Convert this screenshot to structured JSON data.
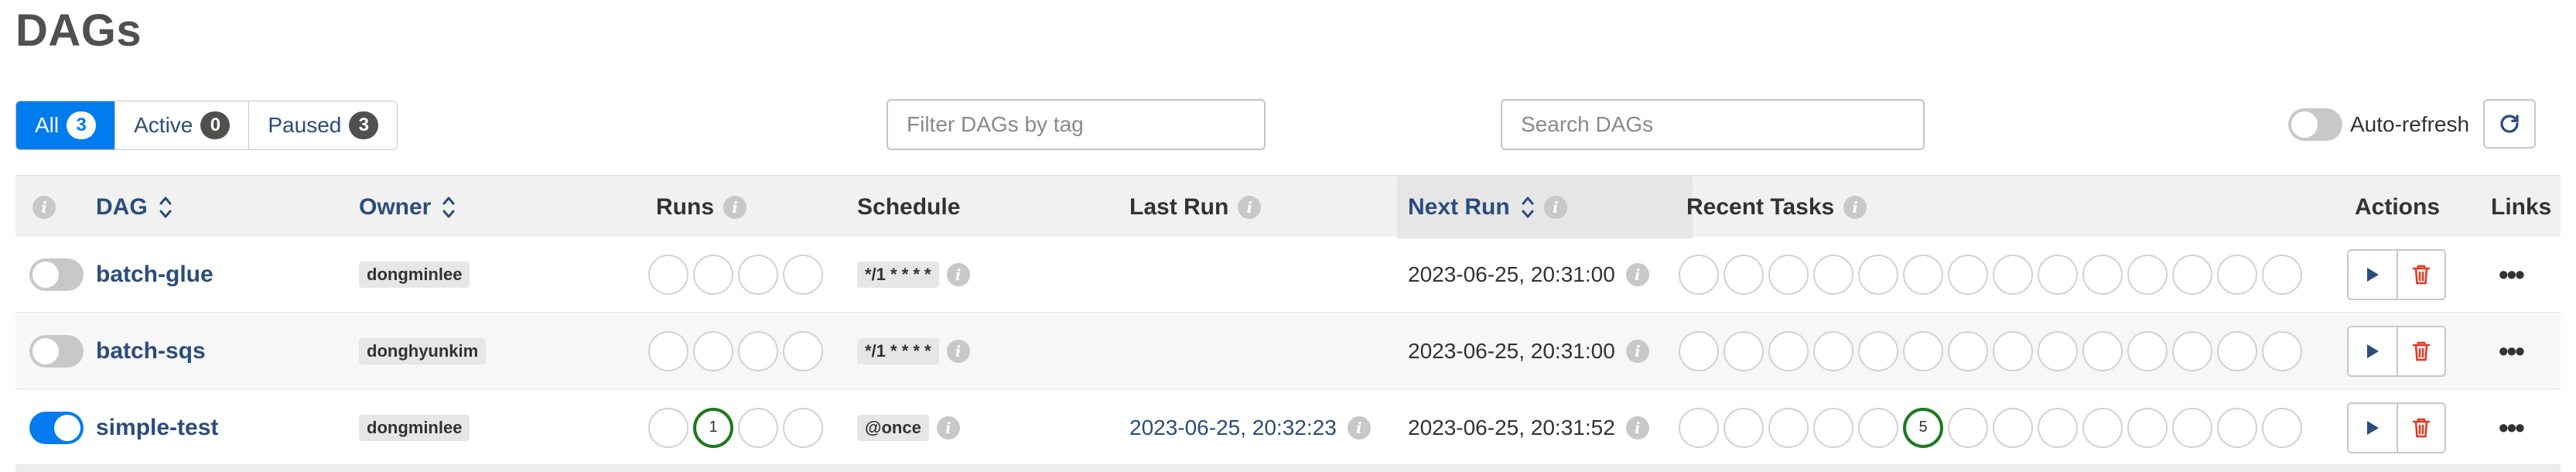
{
  "page_title": "DAGs",
  "status_filters": [
    {
      "label": "All",
      "count": "3",
      "active": true
    },
    {
      "label": "Active",
      "count": "0",
      "active": false
    },
    {
      "label": "Paused",
      "count": "3",
      "active": false
    }
  ],
  "tag_filter": {
    "placeholder": "Filter DAGs by tag",
    "value": ""
  },
  "search": {
    "placeholder": "Search DAGs",
    "value": ""
  },
  "auto_refresh": {
    "label": "Auto-refresh",
    "enabled": false
  },
  "columns": {
    "dag": "DAG",
    "owner": "Owner",
    "runs": "Runs",
    "schedule": "Schedule",
    "last_run": "Last Run",
    "next_run": "Next Run",
    "recent_tasks": "Recent Tasks",
    "actions": "Actions",
    "links": "Links"
  },
  "rows": [
    {
      "enabled": false,
      "name": "batch-glue",
      "owner": "dongminlee",
      "runs": [
        "",
        "",
        "",
        ""
      ],
      "schedule": "*/1 * * * *",
      "last_run": "",
      "next_run": "2023-06-25, 20:31:00",
      "recent_tasks": [
        "",
        "",
        "",
        "",
        "",
        "",
        "",
        "",
        "",
        "",
        "",
        "",
        "",
        ""
      ]
    },
    {
      "enabled": false,
      "name": "batch-sqs",
      "owner": "donghyunkim",
      "runs": [
        "",
        "",
        "",
        ""
      ],
      "schedule": "*/1 * * * *",
      "last_run": "",
      "next_run": "2023-06-25, 20:31:00",
      "recent_tasks": [
        "",
        "",
        "",
        "",
        "",
        "",
        "",
        "",
        "",
        "",
        "",
        "",
        "",
        ""
      ]
    },
    {
      "enabled": true,
      "name": "simple-test",
      "owner": "dongminlee",
      "runs": [
        "",
        "1",
        "",
        ""
      ],
      "schedule": "@once",
      "last_run": "2023-06-25, 20:32:23",
      "next_run": "2023-06-25, 20:31:52",
      "recent_tasks": [
        "",
        "",
        "",
        "",
        "",
        "5",
        "",
        "",
        "",
        "",
        "",
        "",
        "",
        ""
      ]
    }
  ],
  "colors": {
    "accent": "#017cee",
    "link": "#2b4c7e",
    "success": "#1e7a1e",
    "delete": "#e43921",
    "play": "#2b4c7e"
  }
}
